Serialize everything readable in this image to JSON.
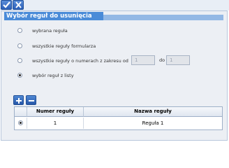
{
  "toolbar": {
    "confirm_icon": "check-icon",
    "cancel_icon": "close-icon"
  },
  "panel": {
    "title": "Wybór reguł do usunięcia",
    "options": [
      {
        "label": "wybrana reguła",
        "selected": false
      },
      {
        "label": "wszystkie reguły formularza",
        "selected": false
      },
      {
        "label": "wszystkie reguły o numerach z zakresu od",
        "selected": false
      },
      {
        "label": "wybór reguł z listy",
        "selected": true
      }
    ],
    "range": {
      "from_value": "1",
      "to_label": "do",
      "to_value": "1"
    },
    "buttons": {
      "add_icon": "plus-icon",
      "remove_icon": "minus-icon"
    },
    "grid": {
      "columns": [
        "",
        "Numer reguły",
        "Nazwa reguły"
      ],
      "rows": [
        {
          "selected": true,
          "number": "1",
          "name": "Reguła 1"
        }
      ]
    }
  }
}
